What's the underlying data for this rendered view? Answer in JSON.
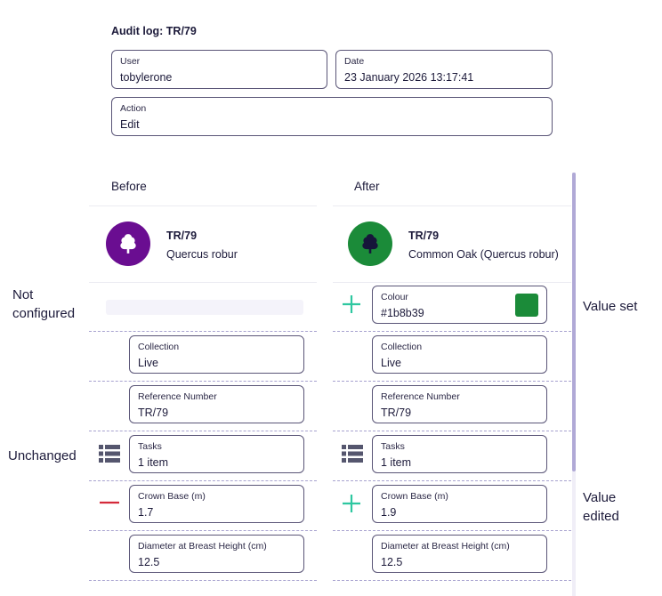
{
  "audit": {
    "title": "Audit log: TR/79"
  },
  "fields": {
    "user": {
      "label": "User",
      "value": "tobylerone"
    },
    "date": {
      "label": "Date",
      "value": "23 January 2026 13:17:41"
    },
    "action": {
      "label": "Action",
      "value": "Edit"
    }
  },
  "columns": {
    "before": "Before",
    "after": "After"
  },
  "before_record": {
    "id": "TR/79",
    "name": "Quercus robur",
    "avatar_color": "#6a0d91"
  },
  "after_record": {
    "id": "TR/79",
    "name": "Common Oak (Quercus robur)",
    "avatar_color": "#1b8b39"
  },
  "rows": {
    "colour": {
      "label": "Colour",
      "after_value": "#1b8b39",
      "swatch": "#1b8b39"
    },
    "collection": {
      "label": "Collection",
      "before_value": "Live",
      "after_value": "Live"
    },
    "reference": {
      "label": "Reference Number",
      "before_value": "TR/79",
      "after_value": "TR/79"
    },
    "tasks": {
      "label": "Tasks",
      "before_value": "1 item",
      "after_value": "1 item"
    },
    "crown_base": {
      "label": "Crown Base (m)",
      "before_value": "1.7",
      "after_value": "1.9"
    },
    "dbh": {
      "label": "Diameter at Breast Height (cm)",
      "before_value": "12.5",
      "after_value": "12.5"
    }
  },
  "side_labels": {
    "not_configured_1": "Not",
    "not_configured_2": "configured",
    "unchanged": "Unchanged",
    "value_set": "Value set",
    "value_edited_1": "Value",
    "value_edited_2": "edited"
  },
  "colors": {
    "added": "#2ec7a0",
    "removed": "#d42a3a",
    "accent": "#b0a9d6"
  },
  "icons": {
    "tree": "tree-icon",
    "list": "list-icon",
    "plus": "plus-icon",
    "minus": "minus-icon"
  }
}
